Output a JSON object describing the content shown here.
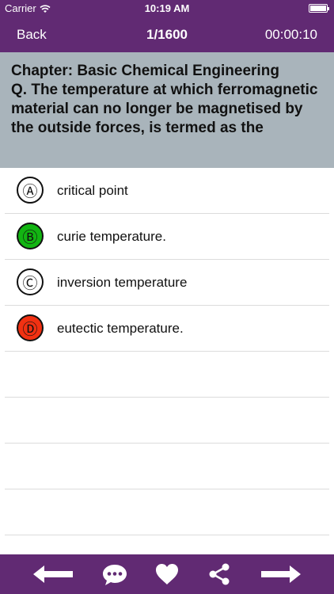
{
  "status_bar": {
    "carrier": "Carrier",
    "time": "10:19 AM"
  },
  "nav": {
    "back_label": "Back",
    "counter": "1/1600",
    "timer": "00:00:10"
  },
  "question": {
    "chapter": "Chapter: Basic Chemical Engineering",
    "text": "Q. The temperature at which ferromagnetic material can no longer be magnetised by the outside forces, is termed as the"
  },
  "options": [
    {
      "letter": "Ⓐ",
      "text": "critical point",
      "badge_color": "#ffffff"
    },
    {
      "letter": "Ⓑ",
      "text": "curie temperature.",
      "badge_color": "#12b512"
    },
    {
      "letter": "Ⓒ",
      "text": "inversion temperature",
      "badge_color": "#ffffff"
    },
    {
      "letter": "Ⓓ",
      "text": "eutectic temperature.",
      "badge_color": "#f23112"
    }
  ],
  "footer": {
    "icons": [
      "arrow-left-icon",
      "chat-icon",
      "heart-icon",
      "share-icon",
      "arrow-right-icon"
    ]
  },
  "colors": {
    "header": "#612a73",
    "question_bg": "#a9b4bb",
    "correct": "#12b512",
    "wrong": "#f23112"
  }
}
